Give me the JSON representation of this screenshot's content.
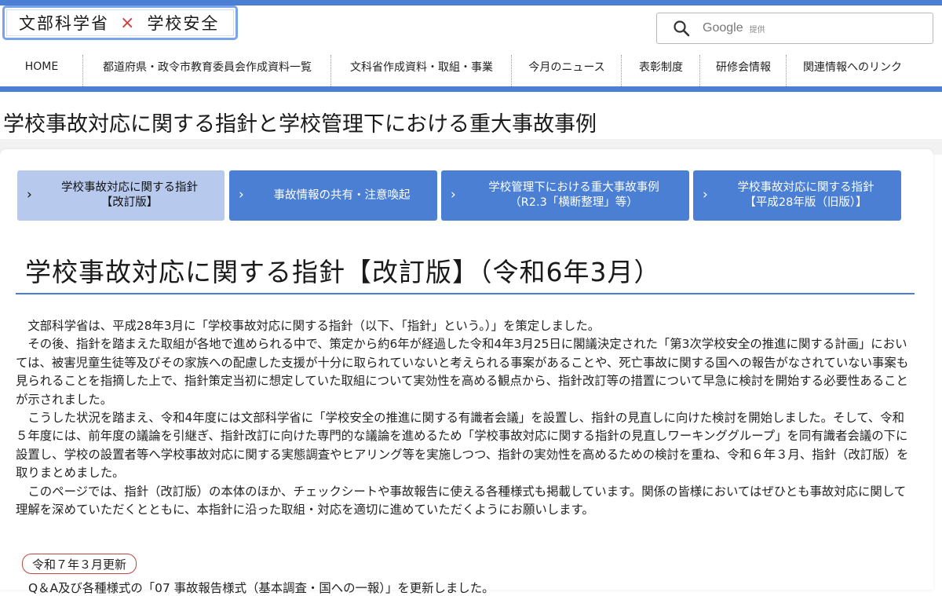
{
  "header": {
    "logo_left": "文部科学省",
    "logo_sep": "×",
    "logo_right": "学校安全",
    "search_brand": "Google",
    "search_provided": "提供"
  },
  "nav": [
    "HOME",
    "都道府県・政令市教育委員会作成資料一覧",
    "文科省作成資料・取組・事業",
    "今月のニュース",
    "表彰制度",
    "研修会情報",
    "関連情報へのリンク"
  ],
  "page_title": "学校事故対応に関する指針と学校管理下における重大事故事例",
  "tabs": [
    {
      "line1": "学校事故対応に関する指針",
      "line2": "【改訂版】",
      "active": true
    },
    {
      "line1": "事故情報の共有・注意喚起",
      "line2": "",
      "active": false
    },
    {
      "line1": "学校管理下における重大事故事例",
      "line2": "（R2.3「横断整理」等）",
      "active": false
    },
    {
      "line1": "学校事故対応に関する指針",
      "line2": "【平成28年版（旧版）】",
      "active": false
    }
  ],
  "section_title": "学校事故対応に関する指針【改訂版】（令和6年3月）",
  "paragraphs": [
    "文部科学省は、平成28年3月に「学校事故対応に関する指針（以下、「指針」という。）」を策定しました。",
    "その後、指針を踏まえた取組が各地で進められる中で、策定から約6年が経過した令和4年3月25日に閣議決定された「第3次学校安全の推進に関する計画」においては、被害児童生徒等及びその家族への配慮した支援が十分に取られていないと考えられる事案があることや、死亡事故に関する国への報告がなされていない事案も見られることを指摘した上で、指針策定当初に想定していた取組について実効性を高める観点から、指針改訂等の措置について早急に検討を開始する必要性あることが示されました。",
    "こうした状況を踏まえ、令和4年度には文部科学省に「学校安全の推進に関する有識者会議」を設置し、指針の見直しに向けた検討を開始しました。そして、令和５年度には、前年度の議論を引継ぎ、指針改訂に向けた専門的な議論を進めるため「学校事故対応に関する指針の見直しワーキンググループ」を同有識者会議の下に設置し、学校の設置者等へ学校事故対応に関する実態調査やヒアリング等を実施しつつ、指針の実効性を高めるための検討を重ね、令和６年３月、指針（改訂版）を取りまとめました。",
    "このページでは、指針（改訂版）の本体のほか、チェックシートや事故報告に使える各種様式も掲載しています。関係の皆様においてはぜひとも事故対応に関して理解を深めていただくとともに、本指針に沿った取組・対応を適切に進めていただくようにお願いします。"
  ],
  "update": {
    "badge": "令和７年３月更新",
    "text": "Q＆A及び各種様式の「07 事故報告様式（基本調査・国への一報）」を更新しました。"
  },
  "colors": {
    "accent": "#4a7fd4",
    "tab_active": "#b7c9ec",
    "badge_border": "#c0463f",
    "logo_x": "#d43b3b"
  }
}
